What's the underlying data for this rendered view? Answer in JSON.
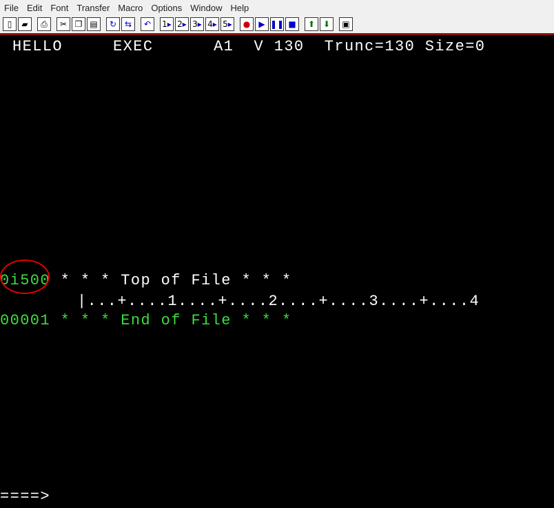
{
  "menu": [
    "File",
    "Edit",
    "Font",
    "Transfer",
    "Macro",
    "Options",
    "Window",
    "Help"
  ],
  "toolbar_icons": [
    "new-doc-icon",
    "open-folder-icon",
    "print-icon",
    "cut-icon",
    "copy-icon",
    "paste-icon",
    "refresh-icon",
    "transfer-icon",
    "undo-icon",
    "macro-1",
    "macro-2",
    "macro-3",
    "macro-4",
    "macro-5",
    "record-icon",
    "play-icon",
    "pause-icon",
    "stop-icon",
    "up-arrow-icon",
    "down-arrow-icon",
    "extra-icon"
  ],
  "toolbar_labels": {
    "m1": "1",
    "m2": "2",
    "m3": "3",
    "m4": "4",
    "m5": "5"
  },
  "status": {
    "filename": "HELLO",
    "filetype": "EXEC",
    "filemode": "A1",
    "format": "V 130",
    "trunc": "Trunc=130",
    "size": "Size=0"
  },
  "lines": {
    "top_prefix": "0i500",
    "top_text": "* * * Top of File * * *",
    "scale": "|...+....1....+....2....+....3....+....4",
    "end_prefix": "00001",
    "end_text": "* * * End of File * * *"
  },
  "command": {
    "prompt": "====>"
  }
}
